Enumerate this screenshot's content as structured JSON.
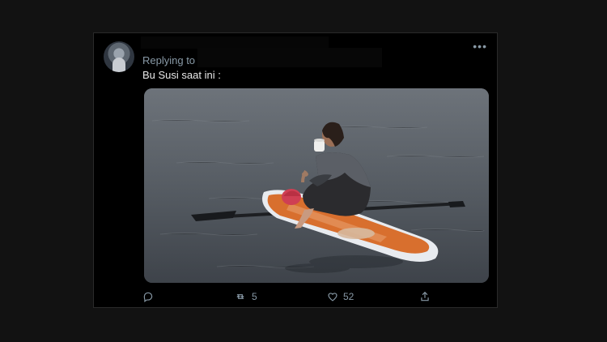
{
  "tweet": {
    "replying_label": "Replying to",
    "text": "Bu Susi saat ini :",
    "more_icon": "more-horizontal-icon",
    "actions": {
      "reply_icon": "reply-icon",
      "retweet_count": "5",
      "like_count": "52",
      "share_icon": "share-icon"
    }
  },
  "colors": {
    "background": "#121212",
    "tweet_background": "#000000",
    "muted_text": "#8899a6",
    "primary_text": "#e8e8e8"
  }
}
